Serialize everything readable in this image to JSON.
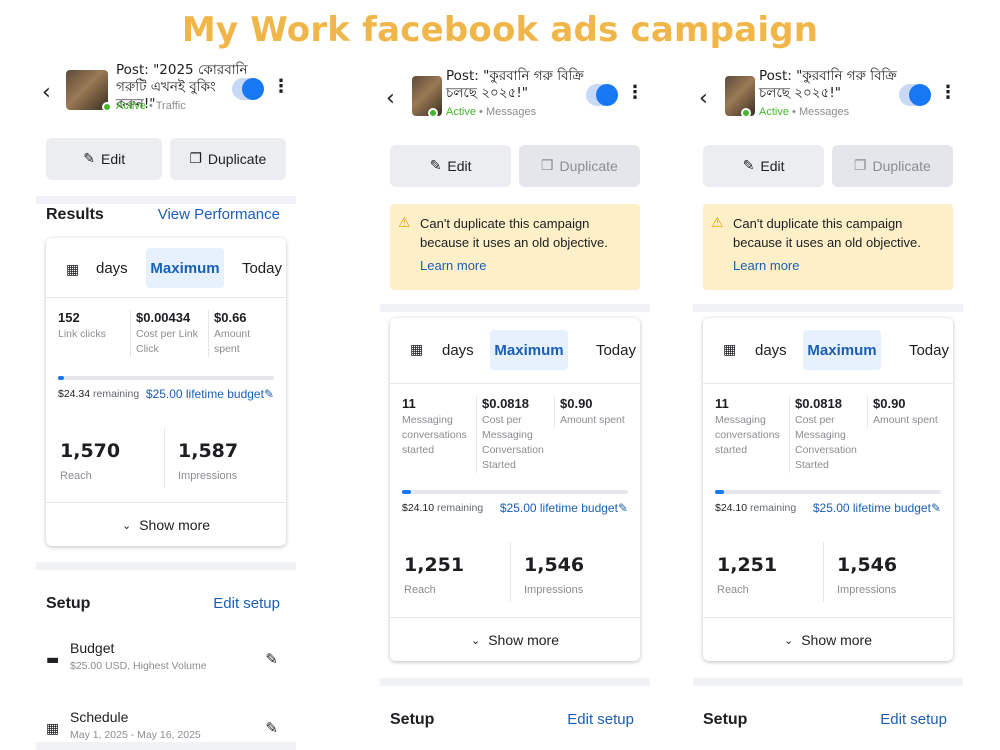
{
  "title": "My Work facebook ads campaign",
  "panels": [
    {
      "post_title": "Post: \"2025 কোরবানি গরুটি এখনই বুকিং করুন!\"",
      "status": "Active",
      "objective": "Traffic",
      "edit_label": "Edit",
      "duplicate_label": "Duplicate",
      "results_title": "Results",
      "view_performance": "View Performance",
      "range_days": "days",
      "range_max": "Maximum",
      "range_today": "Today",
      "metrics": [
        {
          "value": "152",
          "label": "Link clicks"
        },
        {
          "value": "$0.00434",
          "label": "Cost per Link Click"
        },
        {
          "value": "$0.66",
          "label": "Amount spent"
        }
      ],
      "budget_progress": 0.03,
      "remaining_value": "$24.34",
      "remaining_label": "remaining",
      "lifetime_budget": "$25.00 lifetime budget",
      "reach_value": "1,570",
      "reach_label": "Reach",
      "impressions_value": "1,587",
      "impressions_label": "Impressions",
      "show_more": "Show more",
      "setup_title": "Setup",
      "edit_setup": "Edit setup",
      "budget_label": "Budget",
      "budget_sub": "$25.00 USD, Highest Volume",
      "schedule_label": "Schedule",
      "schedule_sub": "May 1, 2025 - May 16, 2025"
    },
    {
      "post_title": "Post: \"কুরবানি গরু বিক্রি চলছে ২০২৫!\"",
      "status": "Active",
      "objective": "Messages",
      "edit_label": "Edit",
      "duplicate_label": "Duplicate",
      "warning_text": "Can't duplicate this campaign because it uses an old objective.",
      "learn_more": "Learn more",
      "range_days": "days",
      "range_max": "Maximum",
      "range_today": "Today",
      "metrics": [
        {
          "value": "11",
          "label": "Messaging conversations started"
        },
        {
          "value": "$0.0818",
          "label": "Cost per Messaging Conversation Started"
        },
        {
          "value": "$0.90",
          "label": "Amount spent"
        }
      ],
      "budget_progress": 0.04,
      "remaining_value": "$24.10",
      "remaining_label": "remaining",
      "lifetime_budget": "$25.00 lifetime budget",
      "reach_value": "1,251",
      "reach_label": "Reach",
      "impressions_value": "1,546",
      "impressions_label": "Impressions",
      "show_more": "Show more",
      "setup_title": "Setup",
      "edit_setup": "Edit setup"
    },
    {
      "post_title": "Post: \"কুরবানি গরু বিক্রি চলছে ২০২৫!\"",
      "status": "Active",
      "objective": "Messages",
      "edit_label": "Edit",
      "duplicate_label": "Duplicate",
      "warning_text": "Can't duplicate this campaign because it uses an old objective.",
      "learn_more": "Learn more",
      "range_days": "days",
      "range_max": "Maximum",
      "range_today": "Today",
      "metrics": [
        {
          "value": "11",
          "label": "Messaging conversations started"
        },
        {
          "value": "$0.0818",
          "label": "Cost per Messaging Conversation Started"
        },
        {
          "value": "$0.90",
          "label": "Amount spent"
        }
      ],
      "budget_progress": 0.04,
      "remaining_value": "$24.10",
      "remaining_label": "remaining",
      "lifetime_budget": "$25.00 lifetime budget",
      "reach_value": "1,251",
      "reach_label": "Reach",
      "impressions_value": "1,546",
      "impressions_label": "Impressions",
      "show_more": "Show more",
      "setup_title": "Setup",
      "edit_setup": "Edit setup"
    }
  ]
}
